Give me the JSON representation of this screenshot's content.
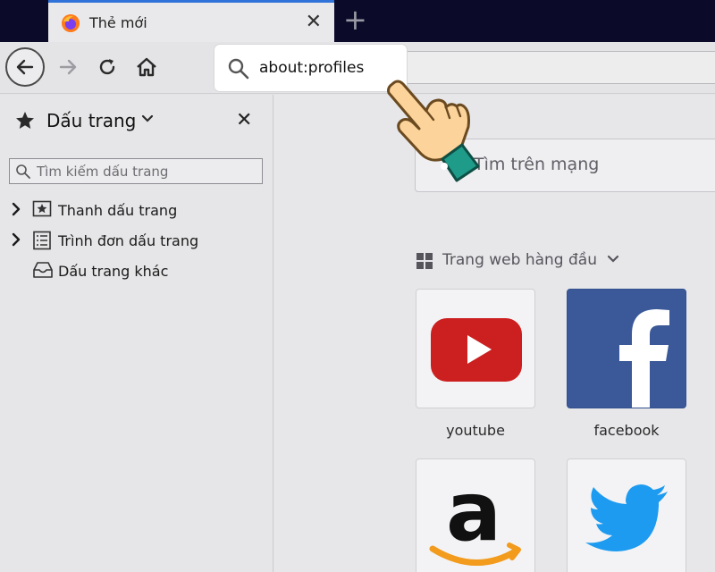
{
  "tab": {
    "title": "Thẻ mới",
    "close": "✕",
    "new_tab": "+"
  },
  "urlbar": {
    "value": "about:profiles"
  },
  "sidebar": {
    "title": "Dấu trang",
    "close": "✕",
    "search_placeholder": "Tìm kiếm dấu trang",
    "items": [
      {
        "label": "Thanh dấu trang"
      },
      {
        "label": "Trình đơn dấu trang"
      },
      {
        "label": "Dấu trang khác"
      }
    ]
  },
  "main": {
    "search_placeholder": "Tìm trên mạng",
    "top_sites_title": "Trang web hàng đầu",
    "tiles": [
      {
        "label": "youtube"
      },
      {
        "label": "facebook"
      },
      {
        "label": ""
      },
      {
        "label": ""
      }
    ]
  },
  "colors": {
    "tab_accent": "#2f72d9",
    "youtube_red": "#cc1f1f",
    "facebook_blue": "#3b5998",
    "twitter_blue": "#1d9bf0",
    "amazon_orange": "#f29b1c",
    "hand_skin": "#fbd39b",
    "cuff_teal": "#1f9b8a"
  }
}
